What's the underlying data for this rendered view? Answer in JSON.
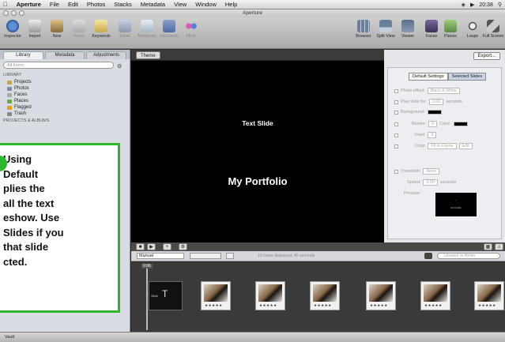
{
  "menubar": {
    "apple": "⌘",
    "app": "Aperture",
    "items": [
      "File",
      "Edit",
      "Photos",
      "Stacks",
      "Metadata",
      "View",
      "Window",
      "Help"
    ],
    "clock": "20:38"
  },
  "window": {
    "title": "Aperture"
  },
  "toolbar": {
    "left": [
      "Inspector",
      "Import",
      "New",
      "Flens",
      "Keywords"
    ],
    "middle": [
      "Email",
      "Mobileme",
      "Facebook",
      "Flickr"
    ],
    "right": [
      "Browser",
      "Split View",
      "Viewer",
      "Faces",
      "Places",
      "Loupe",
      "Full Screen"
    ]
  },
  "library": {
    "tabs": [
      "Library",
      "Metadata",
      "Adjustments"
    ],
    "search_placeholder": "All Items",
    "section_library": "LIBRARY",
    "items": [
      {
        "label": "Projects",
        "color": "#c8a24a"
      },
      {
        "label": "Photos",
        "color": "#7a8aa6"
      },
      {
        "label": "Faces",
        "color": "#a8a8a8"
      },
      {
        "label": "Places",
        "color": "#6aa84f"
      },
      {
        "label": "Flagged",
        "color": "#e0a020"
      },
      {
        "label": "Trash",
        "color": "#888888"
      }
    ],
    "section_projects": "PROJECTS & ALBUMS"
  },
  "viewer": {
    "theme_button": "Theme",
    "slide_text": "Text Slide",
    "slide_title": "My Portfolio"
  },
  "settings": {
    "export_button": "Export...",
    "segments": [
      "Default Settings",
      "Selected Slides"
    ],
    "rows": [
      {
        "label": "Photo effect:",
        "value": "Black & White"
      },
      {
        "label": "Play slide for:",
        "value": "3.00",
        "suffix": "seconds"
      },
      {
        "label": "Background:",
        "value": ""
      },
      {
        "label": "Border:",
        "value": "0",
        "extra": "Color:"
      },
      {
        "label": "Inset:",
        "value": "0"
      },
      {
        "label": "Crop:",
        "value": "Fit in Frame",
        "extra": "Edit"
      },
      {
        "label": "Transition:",
        "value": "None"
      },
      {
        "label": "Speed:",
        "value": "3.00",
        "suffix": "seconds"
      },
      {
        "label": "Preview:",
        "value": ""
      }
    ],
    "preview_title": "My Portfolio"
  },
  "filmstrip": {
    "mode": "Manual",
    "count_text": "10 items displayed, 45 seconds",
    "search_placeholder": "Unrated or Better",
    "playhead_time": "0:06",
    "stars": "★★★★★",
    "text_slide_glyph": "T",
    "text_slide_label": "Slide"
  },
  "statusbar": {
    "text": "Vault"
  },
  "callout": {
    "text": "Using\n     Default\nplies the\n all the text\neshow. Use\nSlides if you\nthat slide\ncted.",
    "border_color": "#2fb62f"
  }
}
